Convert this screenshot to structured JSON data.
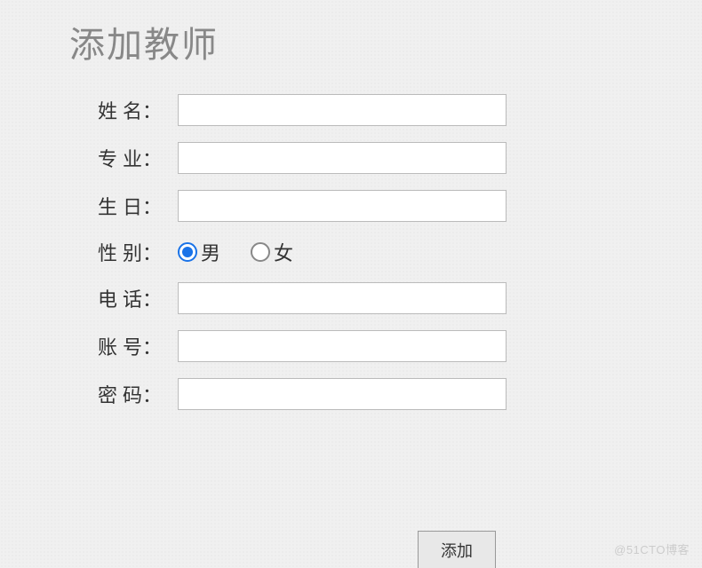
{
  "title": "添加教师",
  "form": {
    "name": {
      "label": "姓名",
      "value": ""
    },
    "major": {
      "label": "专业",
      "value": ""
    },
    "birthday": {
      "label": "生日",
      "value": ""
    },
    "gender": {
      "label": "性别",
      "options": {
        "male": {
          "label": "男",
          "checked": true
        },
        "female": {
          "label": "女",
          "checked": false
        }
      }
    },
    "phone": {
      "label": "电话",
      "value": ""
    },
    "account": {
      "label": "账号",
      "value": ""
    },
    "password": {
      "label": "密码",
      "value": ""
    }
  },
  "submit_label": "添加",
  "watermark": "@51CTO博客"
}
